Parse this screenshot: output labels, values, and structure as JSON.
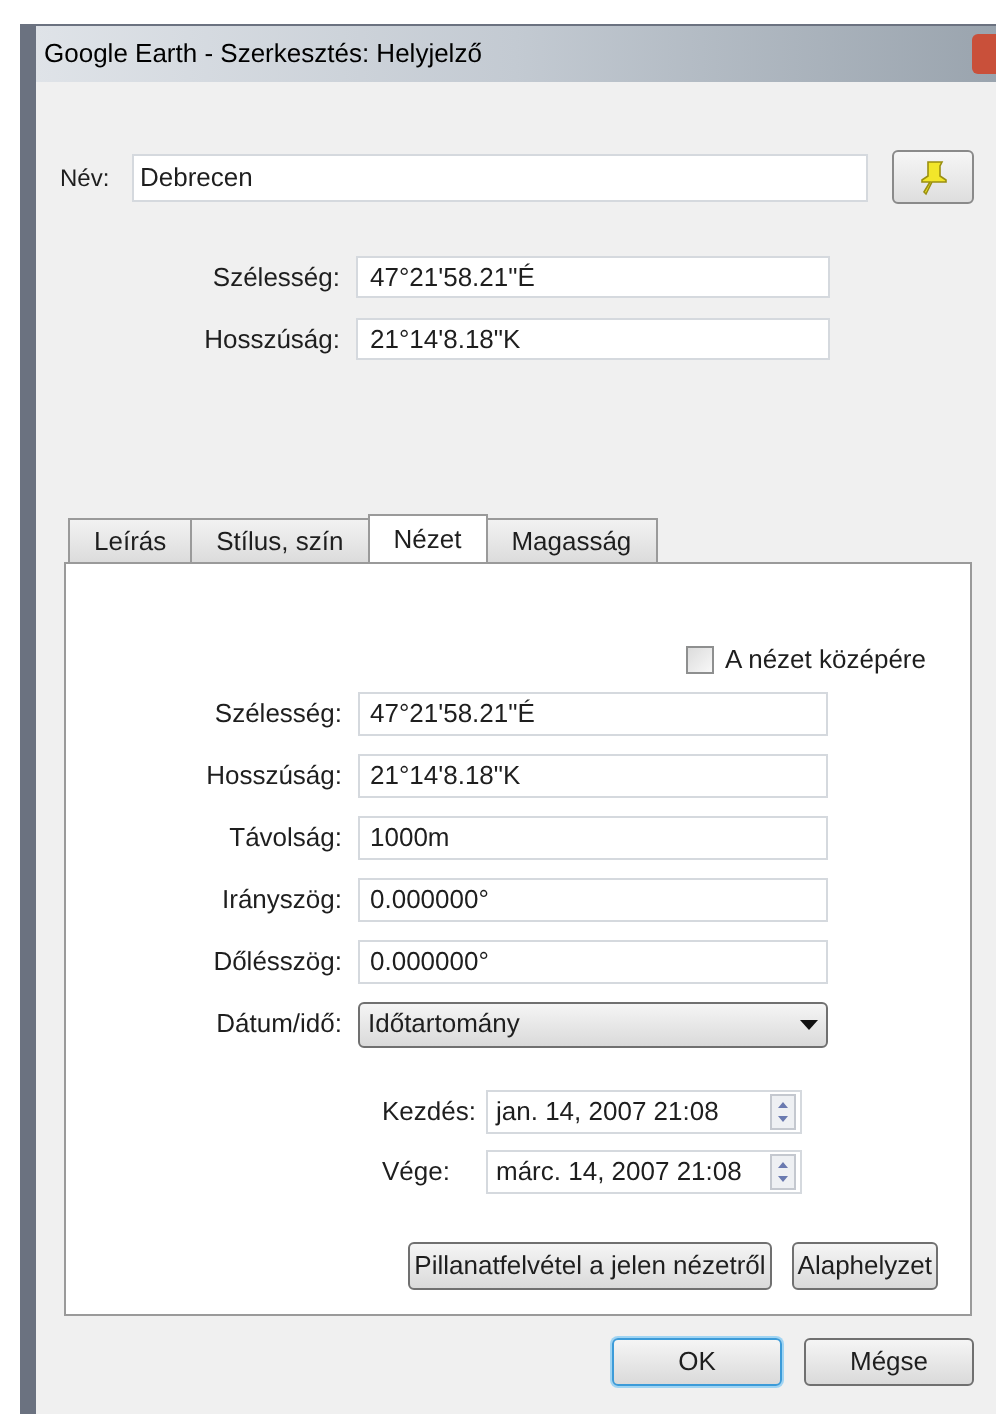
{
  "window": {
    "title": "Google Earth - Szerkesztés: Helyjelző"
  },
  "name": {
    "label": "Név:",
    "value": "Debrecen"
  },
  "coordinates": [
    {
      "label": "Szélesség:",
      "value": "47°21'58.21\"É"
    },
    {
      "label": "Hosszúság:",
      "value": "21°14'8.18\"K"
    }
  ],
  "tabs": [
    {
      "label": "Leírás",
      "selected": false
    },
    {
      "label": "Stílus, szín",
      "selected": false
    },
    {
      "label": "Nézet",
      "selected": true
    },
    {
      "label": "Magasság",
      "selected": false
    }
  ],
  "center_view": {
    "label": "A nézet középére",
    "checked": false
  },
  "view_fields": [
    {
      "label": "Szélesség:",
      "value": "47°21'58.21\"É"
    },
    {
      "label": "Hosszúság:",
      "value": "21°14'8.18\"K"
    },
    {
      "label": "Távolság:",
      "value": "1000m"
    },
    {
      "label": "Irányszög:",
      "value": "0.000000°"
    },
    {
      "label": "Dőlésszög:",
      "value": "0.000000°"
    }
  ],
  "date_time": {
    "label": "Dátum/idő:",
    "value": "Időtartomány"
  },
  "time_range": [
    {
      "label": "Kezdés:",
      "value": "jan. 14, 2007 21:08"
    },
    {
      "label": "Vége:",
      "value": "márc. 14, 2007 21:08"
    }
  ],
  "panel_buttons": [
    "Pillanatfelvétel a jelen nézetről",
    "Alaphelyzet"
  ],
  "dialog_buttons": [
    {
      "label": "OK",
      "default": true
    },
    {
      "label": "Mégse",
      "default": false
    }
  ]
}
